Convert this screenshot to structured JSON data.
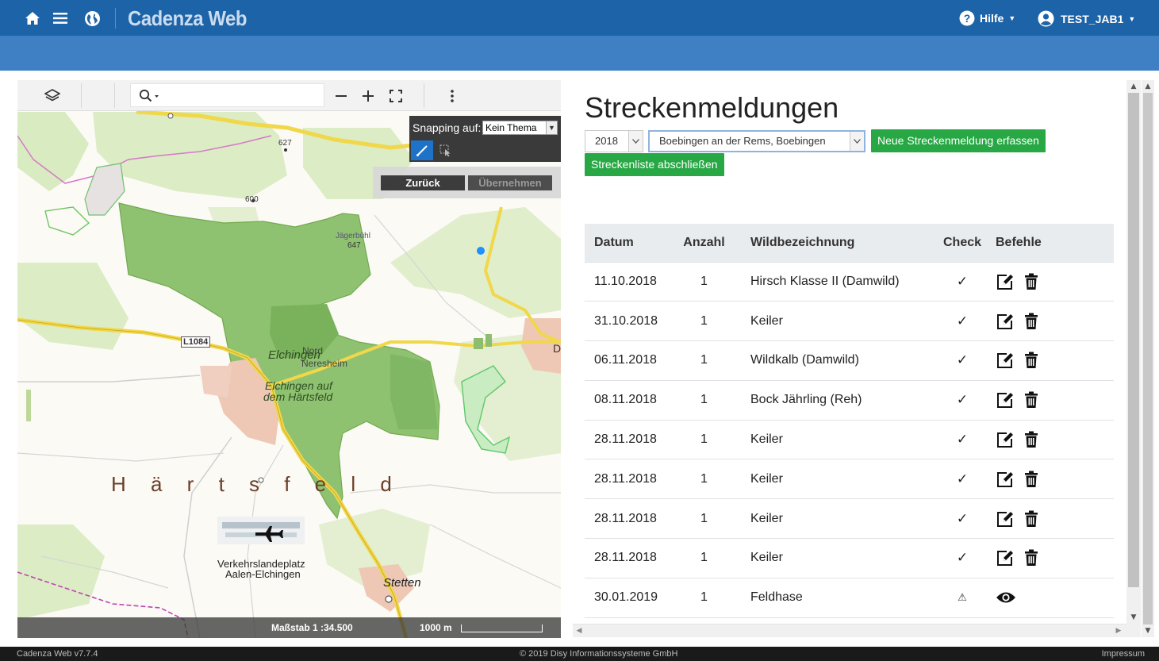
{
  "app": {
    "title": "Cadenza Web"
  },
  "header": {
    "help_label": "Hilfe",
    "user_label": "TEST_JAB1"
  },
  "map": {
    "snapping_label": "Snapping auf:",
    "snapping_value": "Kein Thema",
    "back_button": "Zurück",
    "apply_button": "Übernehmen",
    "scale_label": "Maßstab 1 :34.500",
    "scale_bar_label": "1000 m",
    "labels": {
      "elev_627": "627",
      "elev_600": "600",
      "jaegerbuehl": "Jägerbühl",
      "elev_647": "647",
      "road_l1084": "L1084",
      "elchingen": "Elchingen",
      "nord": "Nord",
      "neresheim": "Neresheim",
      "elchingen_haertsfeld_1": "Elchingen auf",
      "elchingen_haertsfeld_2": "dem Härtsfeld",
      "haertsfeld": "H ä r t s f e l d",
      "airport_1": "Verkehrslandeplatz",
      "airport_2": "Aalen-Elchingen",
      "stetten": "Stetten",
      "edge_d": "D"
    }
  },
  "panel": {
    "title": "Streckenmeldungen",
    "year": "2018",
    "hunting_ground": "Boebingen an der Rems, Boebingen",
    "new_report_button": "Neue Streckenmeldung erfassen",
    "close_list_button": "Streckenliste abschließen"
  },
  "table": {
    "headers": {
      "date": "Datum",
      "count": "Anzahl",
      "game": "Wildbezeichnung",
      "check": "Check",
      "actions": "Befehle"
    },
    "rows": [
      {
        "date": "11.10.2018",
        "count": "1",
        "game": "Hirsch Klasse II (Damwild)",
        "check": "✓"
      },
      {
        "date": "31.10.2018",
        "count": "1",
        "game": "Keiler",
        "check": "✓"
      },
      {
        "date": "06.11.2018",
        "count": "1",
        "game": "Wildkalb (Damwild)",
        "check": "✓"
      },
      {
        "date": "08.11.2018",
        "count": "1",
        "game": "Bock Jährling (Reh)",
        "check": "✓"
      },
      {
        "date": "28.11.2018",
        "count": "1",
        "game": "Keiler",
        "check": "✓"
      },
      {
        "date": "28.11.2018",
        "count": "1",
        "game": "Keiler",
        "check": "✓"
      },
      {
        "date": "28.11.2018",
        "count": "1",
        "game": "Keiler",
        "check": "✓"
      },
      {
        "date": "28.11.2018",
        "count": "1",
        "game": "Keiler",
        "check": "✓"
      },
      {
        "date": "30.01.2019",
        "count": "1",
        "game": "Feldhase",
        "check": "⚠"
      }
    ]
  },
  "footer": {
    "version": "Cadenza Web v7.7.4",
    "copyright": "© 2019 Disy Informationssysteme GmbH",
    "imprint": "Impressum"
  }
}
